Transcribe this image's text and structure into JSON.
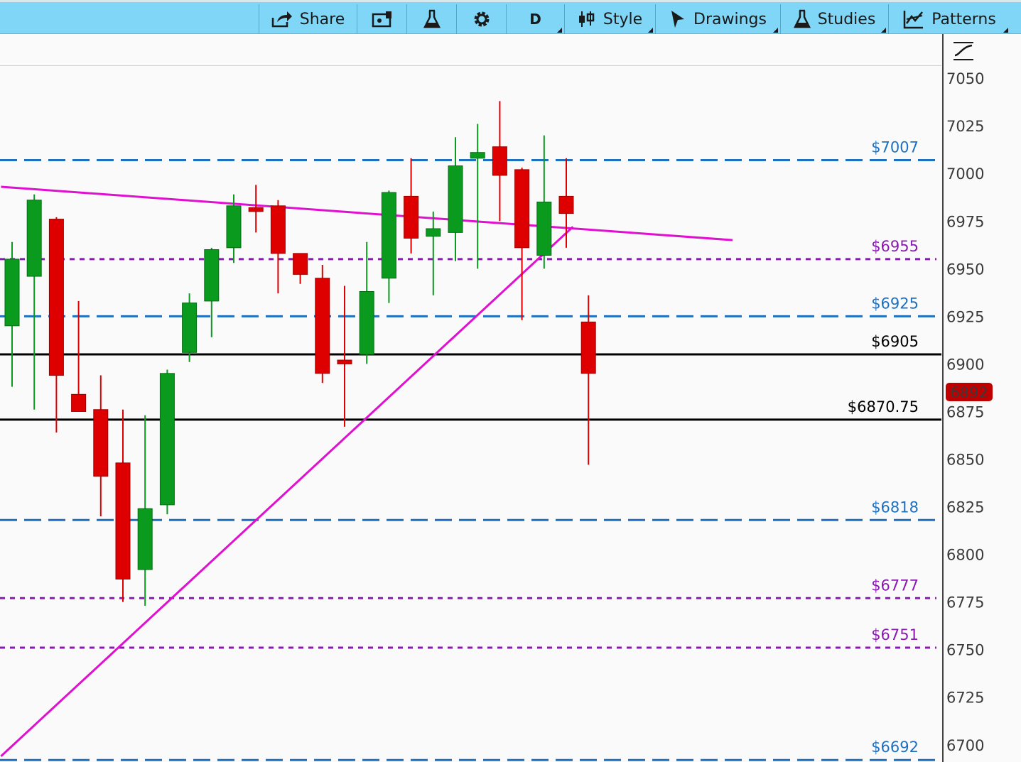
{
  "toolbar": {
    "share_label": "Share",
    "interval_label": "D",
    "style_label": "Style",
    "drawings_label": "Drawings",
    "studies_label": "Studies",
    "patterns_label": "Patterns"
  },
  "colors": {
    "toolbar_bg": "#7fd6f7",
    "up_candle": "#0a9b1e",
    "down_candle": "#de0000",
    "blue_level": "#1e70c0",
    "purple_level": "#8a1ab0",
    "trendline": "#e010d0",
    "black_level": "#000000",
    "price_badge": "#c00000"
  },
  "chart_data": {
    "type": "candlestick",
    "y_ticks": [
      6700,
      6725,
      6750,
      6775,
      6800,
      6825,
      6850,
      6875,
      6900,
      6925,
      6950,
      6975,
      7000,
      7025,
      7050
    ],
    "ylim": [
      6691,
      7072
    ],
    "current_price": "6892",
    "candles": [
      {
        "o": 6920,
        "h": 6964,
        "l": 6888,
        "c": 6955
      },
      {
        "o": 6946,
        "h": 6989,
        "l": 6876,
        "c": 6986
      },
      {
        "o": 6976,
        "h": 6977,
        "l": 6864,
        "c": 6894
      },
      {
        "o": 6884,
        "h": 6933,
        "l": 6877,
        "c": 6875
      },
      {
        "o": 6876,
        "h": 6894,
        "l": 6820,
        "c": 6841
      },
      {
        "o": 6848,
        "h": 6876,
        "l": 6775,
        "c": 6787
      },
      {
        "o": 6792,
        "h": 6873,
        "l": 6773,
        "c": 6824
      },
      {
        "o": 6826,
        "h": 6897,
        "l": 6821,
        "c": 6895
      },
      {
        "o": 6906,
        "h": 6937,
        "l": 6901,
        "c": 6932
      },
      {
        "o": 6933,
        "h": 6961,
        "l": 6914,
        "c": 6960
      },
      {
        "o": 6961,
        "h": 6989,
        "l": 6953,
        "c": 6983
      },
      {
        "o": 6982,
        "h": 6994,
        "l": 6969,
        "c": 6980
      },
      {
        "o": 6983,
        "h": 6986,
        "l": 6937,
        "c": 6958
      },
      {
        "o": 6958,
        "h": 6957,
        "l": 6942,
        "c": 6947
      },
      {
        "o": 6945,
        "h": 6952,
        "l": 6890,
        "c": 6895
      },
      {
        "o": 6902,
        "h": 6941,
        "l": 6867,
        "c": 6900
      },
      {
        "o": 6905,
        "h": 6964,
        "l": 6900,
        "c": 6938
      },
      {
        "o": 6945,
        "h": 6991,
        "l": 6932,
        "c": 6990
      },
      {
        "o": 6988,
        "h": 7008,
        "l": 6958,
        "c": 6966
      },
      {
        "o": 6967,
        "h": 6980,
        "l": 6936,
        "c": 6971
      },
      {
        "o": 6969,
        "h": 7019,
        "l": 6954,
        "c": 7004
      },
      {
        "o": 7008,
        "h": 7026,
        "l": 6950,
        "c": 7011
      },
      {
        "o": 7014,
        "h": 7038,
        "l": 6975,
        "c": 6999
      },
      {
        "o": 7002,
        "h": 7003,
        "l": 6923,
        "c": 6961
      },
      {
        "o": 6957,
        "h": 7020,
        "l": 6950,
        "c": 6985
      },
      {
        "o": 6988,
        "h": 7008,
        "l": 6961,
        "c": 6979
      },
      {
        "o": 6922,
        "h": 6936,
        "l": 6847,
        "c": 6895
      }
    ],
    "levels": [
      {
        "label": "$7007",
        "value": 7007,
        "style": "dashed",
        "color": "blue"
      },
      {
        "label": "$6955",
        "value": 6955,
        "style": "dotted",
        "color": "purple"
      },
      {
        "label": "$6925",
        "value": 6925,
        "style": "dashed",
        "color": "blue"
      },
      {
        "label": "$6905",
        "value": 6905,
        "style": "solid",
        "color": "black"
      },
      {
        "label": "$6870.75",
        "value": 6870.75,
        "style": "solid",
        "color": "black"
      },
      {
        "label": "$6818",
        "value": 6818,
        "style": "dashed",
        "color": "blue"
      },
      {
        "label": "$6777",
        "value": 6777,
        "style": "dotted",
        "color": "purple"
      },
      {
        "label": "$6751",
        "value": 6751,
        "style": "dotted",
        "color": "purple"
      },
      {
        "label": "$6692",
        "value": 6692,
        "style": "dashed",
        "color": "blue"
      }
    ],
    "trendlines": [
      {
        "from": [
          -0.5,
          6993
        ],
        "to": [
          32.5,
          6965
        ]
      },
      {
        "from": [
          -0.5,
          6694
        ],
        "to": [
          25.3,
          6972
        ]
      }
    ]
  }
}
